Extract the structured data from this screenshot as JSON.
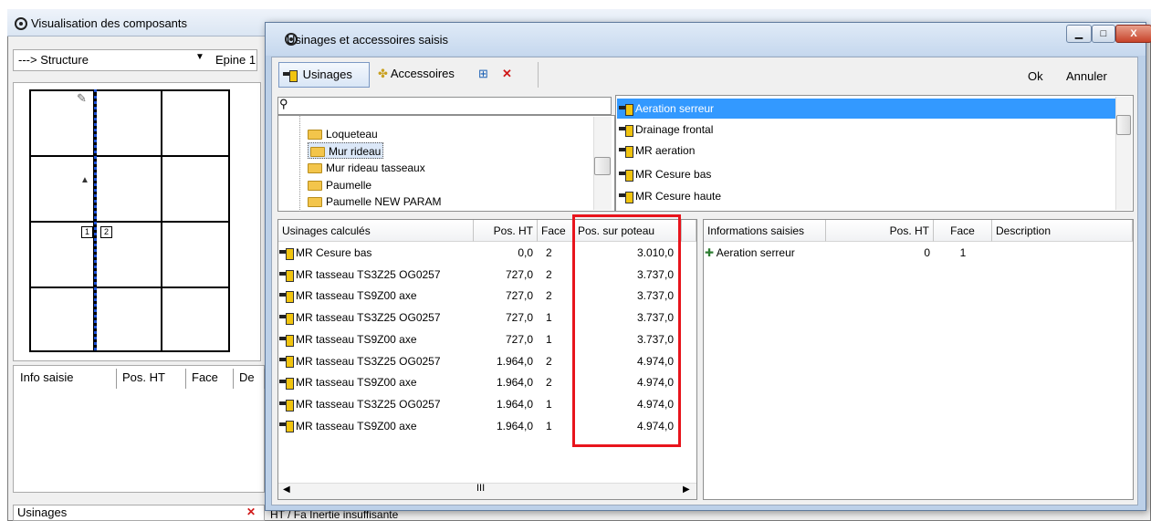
{
  "background_window": {
    "title": "Visualisation des composants",
    "combo_value": "---> Structure",
    "epine_label": "Epine 1",
    "info_headers": [
      "Info saisie",
      "Pos. HT",
      "Face",
      "De"
    ],
    "usinages_label": "Usinages",
    "bottom_text": "HT /      Fa     Inertie insuffisante",
    "grid_labels": [
      "1",
      "2"
    ]
  },
  "dialog": {
    "title": "Usinages et accessoires saisis",
    "toolbar": {
      "usinages_label": "Usinages",
      "accessoires_label": "Accessoires",
      "ok_label": "Ok",
      "annuler_label": "Annuler"
    },
    "search": {
      "value": ""
    },
    "tree_items": [
      {
        "label": "Loqueteau",
        "selected": false
      },
      {
        "label": "Mur rideau",
        "selected": true
      },
      {
        "label": "Mur rideau tasseaux",
        "selected": false
      },
      {
        "label": "Paumelle",
        "selected": false
      },
      {
        "label": "Paumelle NEW PARAM",
        "selected": false
      }
    ],
    "right_list": [
      {
        "label": "Aeration serreur",
        "selected": true
      },
      {
        "label": "Drainage frontal",
        "selected": false
      },
      {
        "label": "MR aeration",
        "selected": false
      },
      {
        "label": "MR Cesure bas",
        "selected": false
      },
      {
        "label": "MR Cesure haute",
        "selected": false
      }
    ],
    "left_table": {
      "headers": [
        "Usinages calculés",
        "Pos. HT",
        "Face",
        "Pos. sur poteau"
      ],
      "rows": [
        {
          "name": "MR Cesure bas",
          "pos_ht": "0,0",
          "face": "2",
          "pos_poteau": "3.010,0"
        },
        {
          "name": "MR tasseau TS3Z25 OG0257",
          "pos_ht": "727,0",
          "face": "2",
          "pos_poteau": "3.737,0"
        },
        {
          "name": "MR tasseau TS9Z00 axe",
          "pos_ht": "727,0",
          "face": "2",
          "pos_poteau": "3.737,0"
        },
        {
          "name": "MR tasseau TS3Z25 OG0257",
          "pos_ht": "727,0",
          "face": "1",
          "pos_poteau": "3.737,0"
        },
        {
          "name": "MR tasseau TS9Z00 axe",
          "pos_ht": "727,0",
          "face": "1",
          "pos_poteau": "3.737,0"
        },
        {
          "name": "MR tasseau TS3Z25 OG0257",
          "pos_ht": "1.964,0",
          "face": "2",
          "pos_poteau": "4.974,0"
        },
        {
          "name": "MR tasseau TS9Z00 axe",
          "pos_ht": "1.964,0",
          "face": "2",
          "pos_poteau": "4.974,0"
        },
        {
          "name": "MR tasseau TS3Z25 OG0257",
          "pos_ht": "1.964,0",
          "face": "1",
          "pos_poteau": "4.974,0"
        },
        {
          "name": "MR tasseau TS9Z00 axe",
          "pos_ht": "1.964,0",
          "face": "1",
          "pos_poteau": "4.974,0"
        }
      ]
    },
    "right_table": {
      "headers": [
        "Informations saisies",
        "Pos. HT",
        "Face",
        "Description"
      ],
      "rows": [
        {
          "name": "Aeration serreur",
          "pos_ht": "0",
          "face": "1",
          "description": ""
        }
      ]
    },
    "scroll_thumb_text": "III"
  },
  "colors": {
    "selection": "#3399ff",
    "highlight": "#e8141c"
  }
}
